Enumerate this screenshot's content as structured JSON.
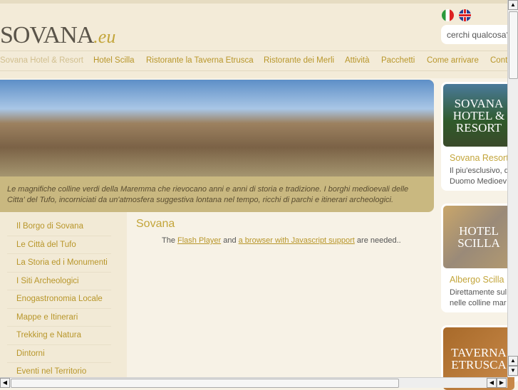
{
  "header": {
    "logo_main": "SOVANA",
    "logo_suffix": ".eu",
    "search_placeholder": "cerchi qualcosa?",
    "flags": [
      "italian-flag",
      "english-flag"
    ]
  },
  "nav": [
    "Sovana Hotel & Resort",
    "Hotel Scilla",
    "Ristorante la Taverna Etrusca",
    "Ristorante dei Merli",
    "Attività",
    "Pacchetti",
    "Come arrivare",
    "Contatti"
  ],
  "banner": {
    "caption": "Le magnifiche colline verdi della Maremma che rievocano anni e anni di storia e tradizione. I borghi medioevali delle Citta' del Tufo, incorniciati da un'atmosfera suggestiva lontana nel tempo, ricchi di parchi e itinerari archeologici."
  },
  "sidebar": [
    "Il Borgo di Sovana",
    "Le Città del Tufo",
    "La Storia ed i Monumenti",
    "I Siti Archeologici",
    "Enogastronomia Locale",
    "Mappe e Itinerari",
    "Trekking e Natura",
    "Dintorni",
    "Eventi nel Territorio"
  ],
  "content": {
    "title": "Sovana",
    "msg_pre": "The ",
    "link1": "Flash Player",
    "msg_mid": " and ",
    "link2": "a browser with Javascript support",
    "msg_post": " are needed.."
  },
  "cards": [
    {
      "image_text": "SOVANA HOTEL & RESORT",
      "title": "Sovana Resort",
      "line1": "Il piu'esclusivo, d",
      "line2": "Duomo Medioev"
    },
    {
      "image_text": "HOTEL SCILLA",
      "title": "Albergo Scilla",
      "line1": "Direttamente sul",
      "line2": "nelle colline mar"
    },
    {
      "image_text": "TAVERNA ETRUSCA"
    }
  ]
}
